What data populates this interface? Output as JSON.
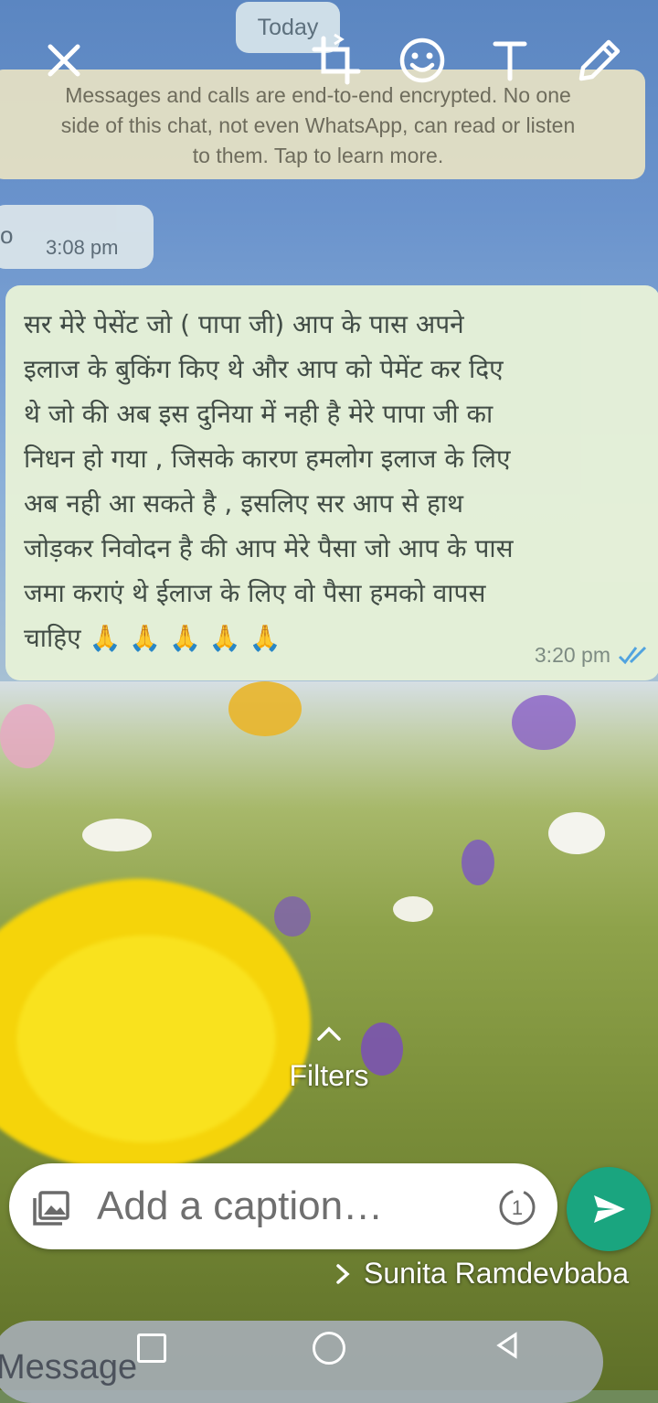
{
  "chat": {
    "date_chip": "Today",
    "encryption_lines": [
      "Messages and calls are end-to-end encrypted. No one",
      "side of this chat, not even WhatsApp, can read or listen",
      "to them. Tap to learn more."
    ],
    "incoming": {
      "text": "o",
      "time": "3:08 pm"
    },
    "outgoing": {
      "lines": [
        "सर मेरे पेसेंट जो ( पापा जी) आप के पास अपने",
        "इलाज के बुकिंग किए थे और आप को पेमेंट कर दिए",
        "थे जो की अब इस दुनिया में नही है मेरे पापा जी का",
        "निधन हो गया , जिसके कारण हमलोग इलाज के लिए",
        "अब नही आ सकते है , इसलिए सर आप से हाथ",
        "जोड़कर निवोदन है की आप मेरे पैसा जो आप के पास",
        "जमा कराएं थे ईलाज के लिए वो पैसा हमको वापस",
        "चाहिए 🙏 🙏 🙏 🙏 🙏"
      ],
      "time": "3:20 pm"
    }
  },
  "editor": {
    "filters_label": "Filters",
    "caption_placeholder": "Add a caption…",
    "view_once_label": "1",
    "recipient": "Sunita Ramdevbaba"
  },
  "background_chat": {
    "message_placeholder": "Message"
  },
  "colors": {
    "send_button": "#1aa57f",
    "outgoing_bubble": "#e6f1d8",
    "encryption_notice": "#e7e2c4"
  }
}
